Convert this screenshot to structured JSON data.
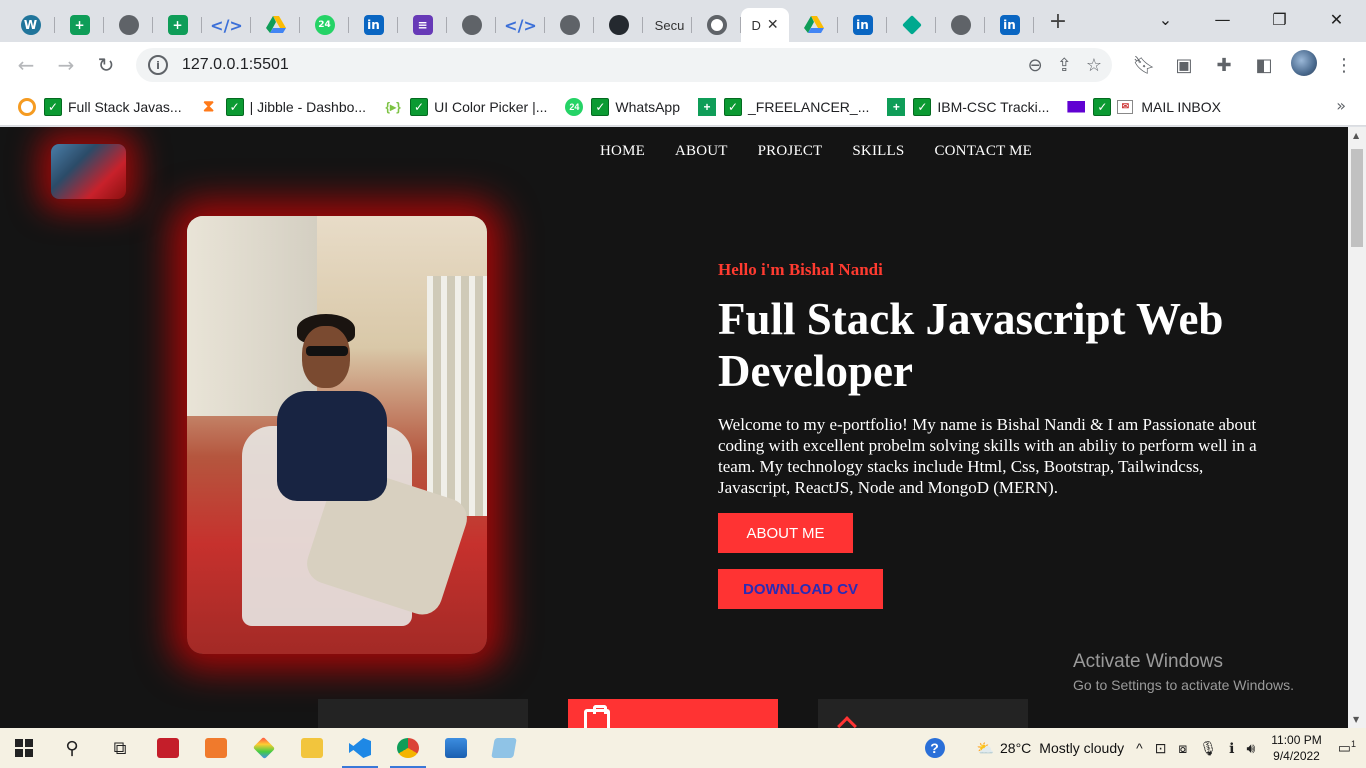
{
  "browser": {
    "tabs": [
      {
        "icon": "wordpress-icon",
        "text": "",
        "color": "#21759b"
      },
      {
        "icon": "sheets-icon",
        "text": "",
        "color": "#0f9d58"
      },
      {
        "icon": "globe-icon",
        "text": "",
        "color": "#5f6368"
      },
      {
        "icon": "sheets-icon",
        "text": "",
        "color": "#0f9d58"
      },
      {
        "icon": "code-icon",
        "text": "",
        "color": "#3b6fd8"
      },
      {
        "icon": "drive-icon",
        "text": "",
        "color": "#fbbc04"
      },
      {
        "icon": "whatsapp24-icon",
        "text": "",
        "color": "#25d366"
      },
      {
        "icon": "linkedin-icon",
        "text": "",
        "color": "#0a66c2"
      },
      {
        "icon": "forms-icon",
        "text": "",
        "color": "#673ab7"
      },
      {
        "icon": "globe-icon",
        "text": "",
        "color": "#5f6368"
      },
      {
        "icon": "code-icon",
        "text": "",
        "color": "#3b6fd8"
      },
      {
        "icon": "globe-icon",
        "text": "",
        "color": "#5f6368"
      },
      {
        "icon": "github-icon",
        "text": "",
        "color": "#24292f"
      },
      {
        "icon": "none",
        "text": "Secu",
        "color": "#5f6368"
      },
      {
        "icon": "chrome-icon",
        "text": "",
        "color": "#5f6368"
      },
      {
        "icon": "none",
        "text": "D",
        "color": "#5f6368",
        "active": true
      },
      {
        "icon": "drive-icon",
        "text": "",
        "color": "#fbbc04"
      },
      {
        "icon": "linkedin-icon",
        "text": "",
        "color": "#0a66c2"
      },
      {
        "icon": "diamond-icon",
        "text": "",
        "color": "#00a98f"
      },
      {
        "icon": "globe-icon",
        "text": "",
        "color": "#5f6368"
      },
      {
        "icon": "linkedin-icon",
        "text": "",
        "color": "#0a66c2"
      }
    ],
    "new_tab": "+",
    "url": "127.0.0.1:5501",
    "bookmarks": [
      {
        "label": "Full Stack Javas...",
        "icon_color": "#f59b21"
      },
      {
        "label": "| Jibble - Dashbo...",
        "icon_color": "#ff7a1a"
      },
      {
        "label": "UI Color Picker |...",
        "icon_color": "#7cc243"
      },
      {
        "label": "WhatsApp",
        "icon_color": "#25d366"
      },
      {
        "label": "_FREELANCER_...",
        "icon_color": "#0f9d58"
      },
      {
        "label": "IBM-CSC Tracki...",
        "icon_color": "#0f9d58"
      },
      {
        "label": "MAIL INBOX",
        "icon_color": "#6001d2"
      }
    ],
    "more": "»"
  },
  "page": {
    "nav": [
      "HOME",
      "ABOUT",
      "PROJECT",
      "SKILLS",
      "CONTACT ME"
    ],
    "hello": "Hello i'm Bishal Nandi",
    "headline": "Full Stack Javascript Web Developer",
    "intro": "Welcome to my e-portfolio! My name is Bishal Nandi & I am Passionate about coding with excellent probelm solving skills with an abiliy to perform well in a team. My technology stacks include Html, Css, Bootstrap, Tailwindcss, Javascript, ReactJS, Node and MongoD (MERN).",
    "about_button": "ABOUT ME",
    "cv_button": "DOWNLOAD CV",
    "accent": "#ff3333"
  },
  "watermark": {
    "line1": "Activate Windows",
    "line2": "Go to Settings to activate Windows."
  },
  "taskbar": {
    "weather_temp": "28°C",
    "weather_text": "Mostly cloudy",
    "time": "11:00 PM",
    "date": "9/4/2022",
    "notification_count": "1"
  }
}
